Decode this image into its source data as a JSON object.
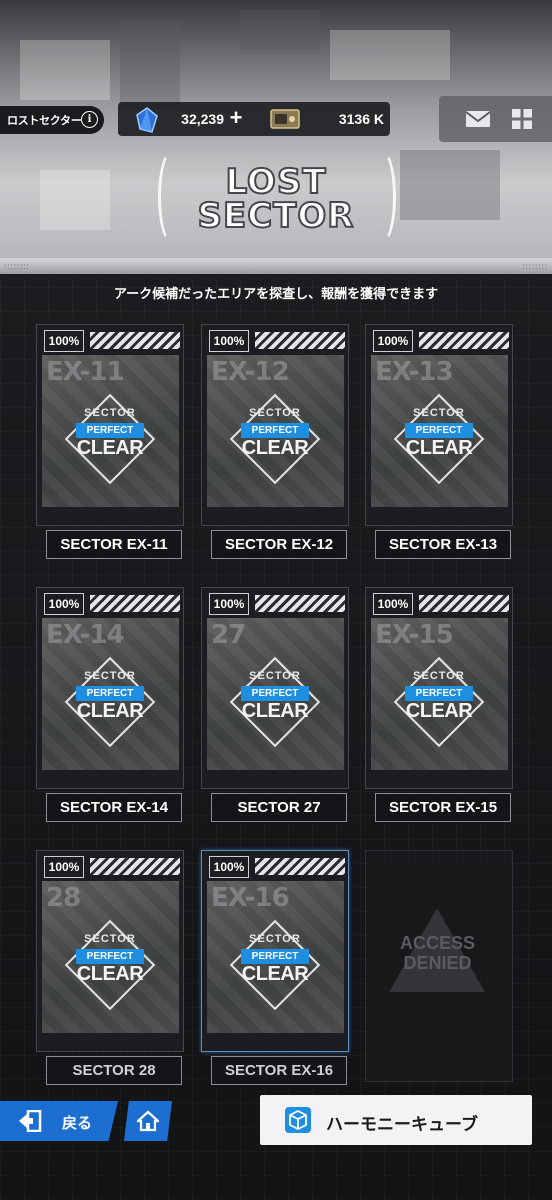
{
  "header": {
    "location_label": "ロストセクター",
    "gems": "32,239",
    "credits": "3136 K",
    "title_line1": "LOST",
    "title_line2": "SECTOR"
  },
  "subtitle": "アーク候補だったエリアを探査し、報酬を獲得できます",
  "cards": [
    {
      "pct": "100%",
      "code": "EX-11",
      "emblem_top": "SECTOR",
      "emblem_mid": "PERFECT",
      "emblem_bottom": "CLEAR",
      "label": "SECTOR EX-11"
    },
    {
      "pct": "100%",
      "code": "EX-12",
      "emblem_top": "SECTOR",
      "emblem_mid": "PERFECT",
      "emblem_bottom": "CLEAR",
      "label": "SECTOR EX-12"
    },
    {
      "pct": "100%",
      "code": "EX-13",
      "emblem_top": "SECTOR",
      "emblem_mid": "PERFECT",
      "emblem_bottom": "CLEAR",
      "label": "SECTOR EX-13"
    },
    {
      "pct": "100%",
      "code": "EX-14",
      "emblem_top": "SECTOR",
      "emblem_mid": "PERFECT",
      "emblem_bottom": "CLEAR",
      "label": "SECTOR EX-14"
    },
    {
      "pct": "100%",
      "code": "27",
      "emblem_top": "SECTOR",
      "emblem_mid": "PERFECT",
      "emblem_bottom": "CLEAR",
      "label": "SECTOR 27"
    },
    {
      "pct": "100%",
      "code": "EX-15",
      "emblem_top": "SECTOR",
      "emblem_mid": "PERFECT",
      "emblem_bottom": "CLEAR",
      "label": "SECTOR EX-15"
    },
    {
      "pct": "100%",
      "code": "28",
      "emblem_top": "SECTOR",
      "emblem_mid": "PERFECT",
      "emblem_bottom": "CLEAR",
      "label": "SECTOR 28"
    },
    {
      "pct": "100%",
      "code": "EX-16",
      "emblem_top": "SECTOR",
      "emblem_mid": "PERFECT",
      "emblem_bottom": "CLEAR",
      "label": "SECTOR EX-16"
    }
  ],
  "access_denied": {
    "line1": "ACCESS",
    "line2": "DENIED"
  },
  "footer": {
    "back_label": "戻る",
    "cube_label": "ハーモニーキューブ"
  },
  "colors": {
    "accent_blue": "#1c6fd0",
    "perfect_badge": "#1e8fe0",
    "background": "#111214"
  },
  "icons": [
    "info-icon",
    "crystal-icon",
    "plus-icon",
    "ticket-icon",
    "mail-icon",
    "grid-menu-icon",
    "exit-icon",
    "home-icon",
    "cube-icon"
  ]
}
